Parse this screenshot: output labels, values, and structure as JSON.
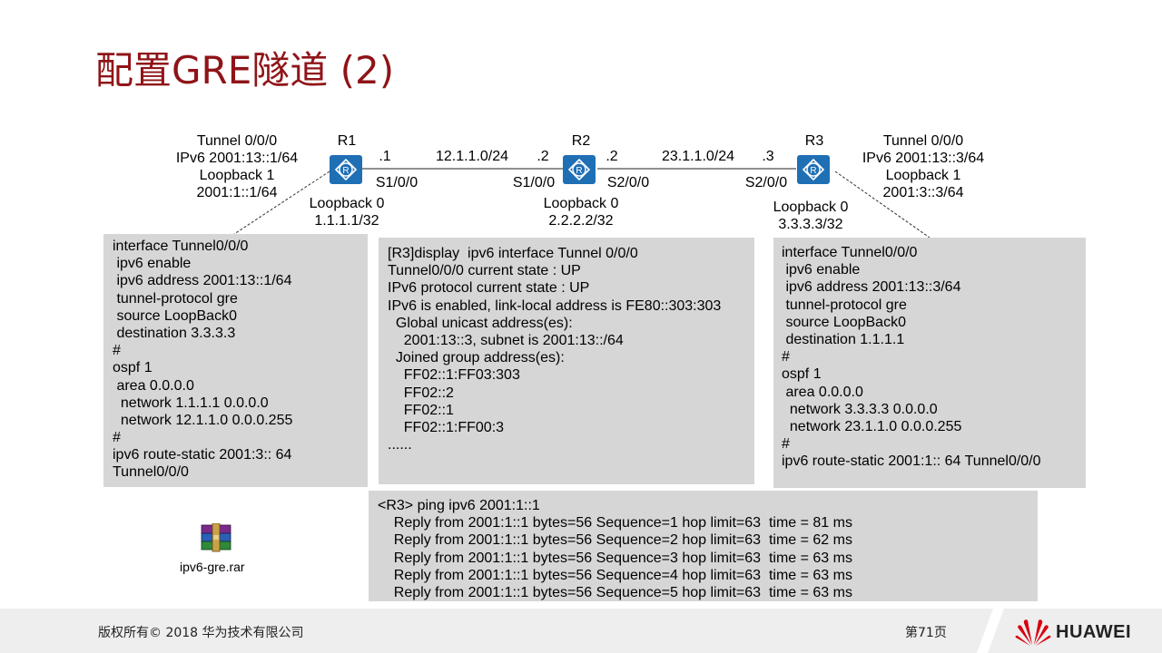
{
  "title": "配置GRE隧道 (2)",
  "topology": {
    "r1": {
      "name": "R1",
      "tunnel": "Tunnel 0/0/0",
      "tunnel_ip": "IPv6 2001:13::1/64",
      "loopback1": "Loopback 1",
      "loopback1_ip": "2001:1::1/64",
      "loopback0": "Loopback 0",
      "loopback0_ip": "1.1.1.1/32",
      "host_id": ".1",
      "interface": "S1/0/0"
    },
    "r2": {
      "name": "R2",
      "host_id_left": ".2",
      "host_id_right": ".2",
      "interface_left": "S1/0/0",
      "interface_right": "S2/0/0",
      "loopback0": "Loopback 0",
      "loopback0_ip": "2.2.2.2/32"
    },
    "r3": {
      "name": "R3",
      "tunnel": "Tunnel 0/0/0",
      "tunnel_ip": "IPv6 2001:13::3/64",
      "loopback1": "Loopback 1",
      "loopback1_ip": "2001:3::3/64",
      "loopback0": "Loopback 0",
      "loopback0_ip": "3.3.3.3/32",
      "host_id": ".3",
      "interface": "S2/0/0"
    },
    "link_r1_r2": "12.1.1.0/24",
    "link_r2_r3": "23.1.1.0/24"
  },
  "config_r1": [
    "interface Tunnel0/0/0",
    " ipv6 enable",
    " ipv6 address 2001:13::1/64",
    " tunnel-protocol gre",
    " source LoopBack0",
    " destination 3.3.3.3",
    "#",
    "ospf 1",
    " area 0.0.0.0",
    "  network 1.1.1.1 0.0.0.0",
    "  network 12.1.1.0 0.0.0.255",
    "#",
    "ipv6 route-static 2001:3:: 64",
    "Tunnel0/0/0"
  ],
  "display_output": [
    "[R3]display  ipv6 interface Tunnel 0/0/0",
    "Tunnel0/0/0 current state : UP",
    "IPv6 protocol current state : UP",
    "IPv6 is enabled, link-local address is FE80::303:303",
    "  Global unicast address(es):",
    "    2001:13::3, subnet is 2001:13::/64",
    "  Joined group address(es):",
    "    FF02::1:FF03:303",
    "    FF02::2",
    "    FF02::1",
    "    FF02::1:FF00:3",
    "......"
  ],
  "config_r3": [
    "interface Tunnel0/0/0",
    " ipv6 enable",
    " ipv6 address 2001:13::3/64",
    " tunnel-protocol gre",
    " source LoopBack0",
    " destination 1.1.1.1",
    "#",
    "ospf 1",
    " area 0.0.0.0",
    "  network 3.3.3.3 0.0.0.0",
    "  network 23.1.1.0 0.0.0.255",
    "#",
    "ipv6 route-static 2001:1:: 64 Tunnel0/0/0"
  ],
  "ping_output": [
    "<R3> ping ipv6 2001:1::1",
    "    Reply from 2001:1::1 bytes=56 Sequence=1 hop limit=63  time = 81 ms",
    "    Reply from 2001:1::1 bytes=56 Sequence=2 hop limit=63  time = 62 ms",
    "    Reply from 2001:1::1 bytes=56 Sequence=3 hop limit=63  time = 63 ms",
    "    Reply from 2001:1::1 bytes=56 Sequence=4 hop limit=63  time = 63 ms",
    "    Reply from 2001:1::1 bytes=56 Sequence=5 hop limit=63  time = 63 ms"
  ],
  "attachment": {
    "filename": "ipv6-gre.rar",
    "icon": "winrar-archive-icon"
  },
  "footer": {
    "copyright": "版权所有© 2018 华为技术有限公司",
    "page": "第71页",
    "brand": "HUAWEI"
  },
  "colors": {
    "title": "#8f1418",
    "router": "#1f6fb5",
    "box_bg": "#d6d6d6",
    "huawei_red": "#d7000f"
  }
}
